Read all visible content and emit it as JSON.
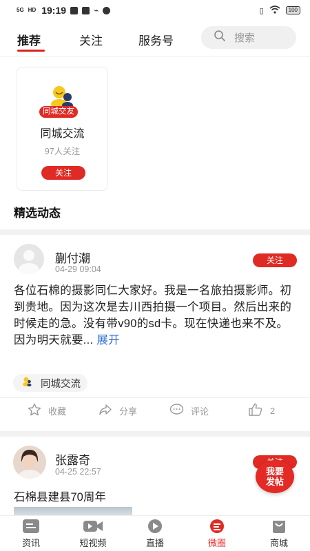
{
  "status_bar": {
    "signal": "5G",
    "network": "HD",
    "time": "19:19",
    "battery": "100"
  },
  "top_tabs": [
    {
      "label": "推荐",
      "active": true
    },
    {
      "label": "关注",
      "active": false
    },
    {
      "label": "服务号",
      "active": false
    }
  ],
  "search": {
    "placeholder": "搜索"
  },
  "circle_card": {
    "tag": "同城交友",
    "name": "同城交流",
    "follower_count": "97人关注",
    "follow_label": "关注"
  },
  "section_title": "精选动态",
  "posts": [
    {
      "user": "蒯付潮",
      "time": "04-29 09:04",
      "follow_label": "关注",
      "text": "各位石棉的摄影同仁大家好。我是一名旅拍摄影师。初到贵地。因为这次是去川西拍摄一个项目。然后出来的时候走的急。没有带v90的sd卡。现在快递也来不及。因为明天就要...",
      "expand_label": "展开",
      "topic": "同城交流",
      "actions": {
        "favorite": "收藏",
        "share": "分享",
        "comment": "评论",
        "like_count": "2"
      }
    },
    {
      "user": "张露奇",
      "time": "04-25 22:57",
      "follow_label": "关注",
      "text": "石棉县建县70周年"
    }
  ],
  "fab": {
    "line1": "我要",
    "line2": "发帖"
  },
  "bottom_nav": [
    {
      "label": "资讯",
      "icon": "news-icon",
      "active": false
    },
    {
      "label": "短视频",
      "icon": "video-camera-icon",
      "active": false
    },
    {
      "label": "直播",
      "icon": "live-play-icon",
      "active": false
    },
    {
      "label": "微圈",
      "icon": "circle-chat-icon",
      "active": true
    },
    {
      "label": "商城",
      "icon": "shopping-bag-icon",
      "active": false
    }
  ],
  "colors": {
    "accent_red": "#e02a24",
    "link_blue": "#2f6fd6",
    "muted_gray": "#999999"
  }
}
